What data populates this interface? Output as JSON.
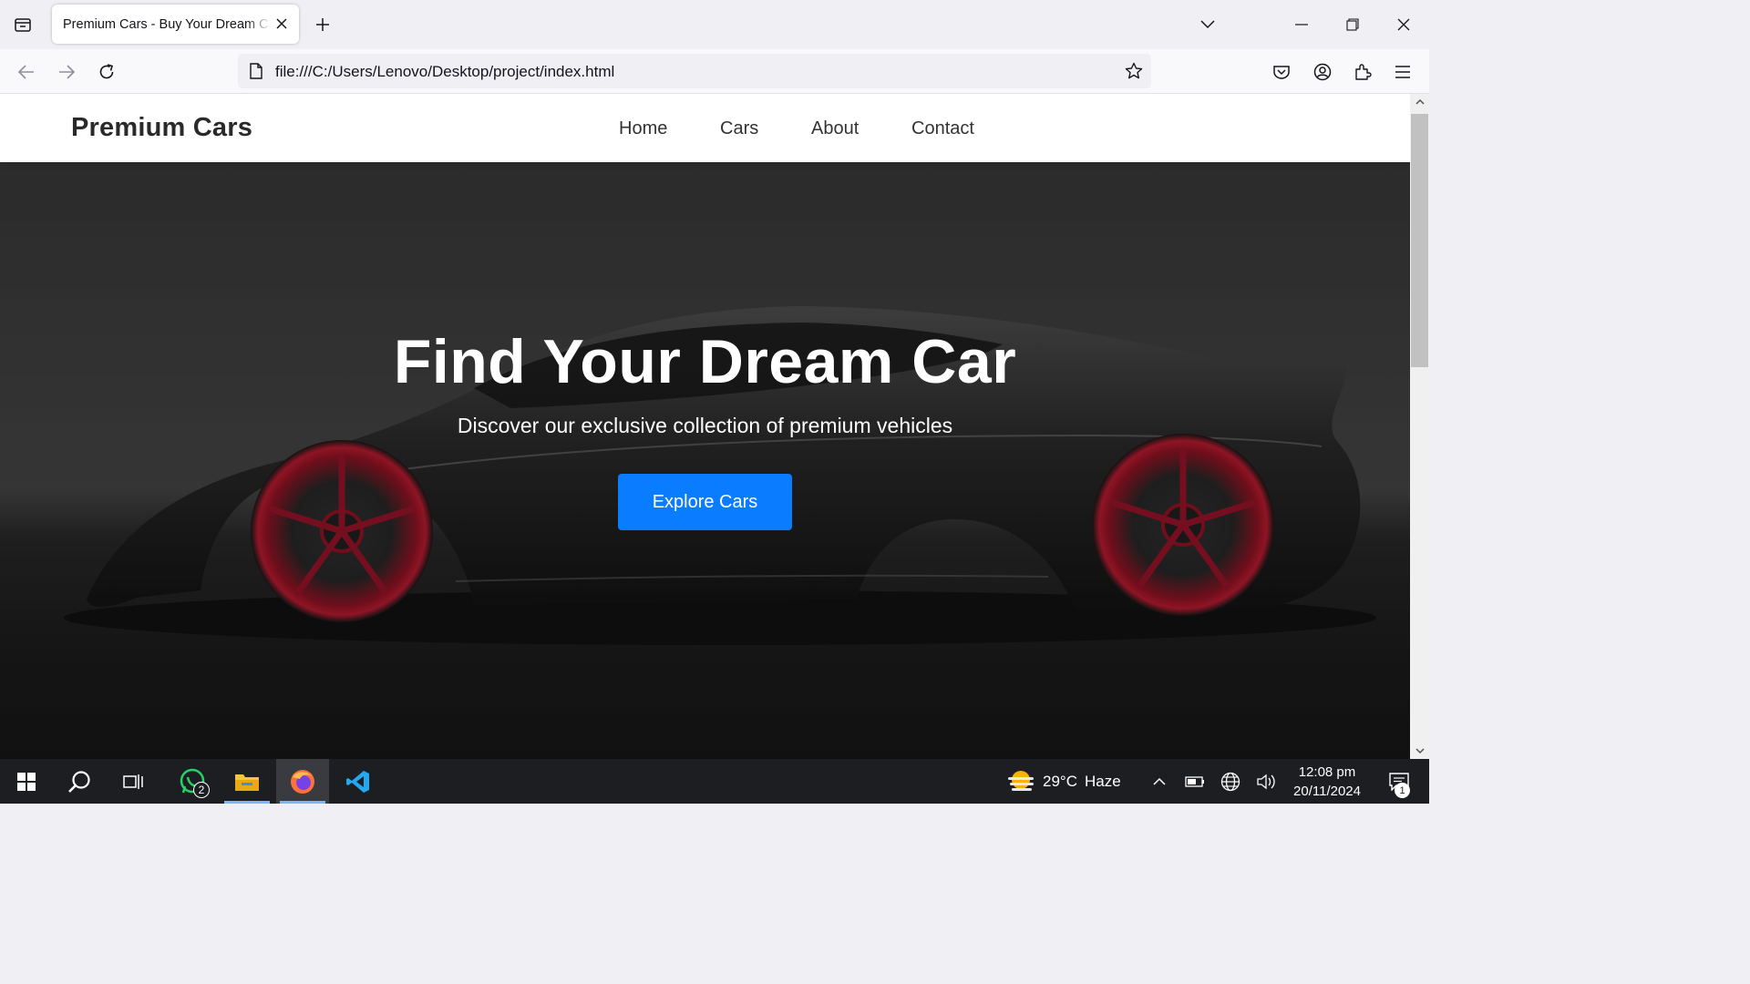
{
  "browser": {
    "tab_title": "Premium Cars - Buy Your Dream Car",
    "url": "file:///C:/Users/Lenovo/Desktop/project/index.html"
  },
  "site": {
    "logo": "Premium Cars",
    "menu": [
      {
        "label": "Home"
      },
      {
        "label": "Cars"
      },
      {
        "label": "About"
      },
      {
        "label": "Contact"
      }
    ],
    "hero": {
      "title": "Find Your Dream Car",
      "subtitle": "Discover our exclusive collection of premium vehicles",
      "cta": "Explore Cars"
    }
  },
  "taskbar": {
    "whatsapp_badge": "2",
    "weather": {
      "temp": "29°C",
      "condition": "Haze"
    },
    "clock": {
      "time": "12:08 pm",
      "date": "20/11/2024"
    },
    "notification_count": "1"
  },
  "colors": {
    "cta": "#0a7cff",
    "wheel_red": "#b3172b",
    "taskbar": "#1d1e22"
  }
}
